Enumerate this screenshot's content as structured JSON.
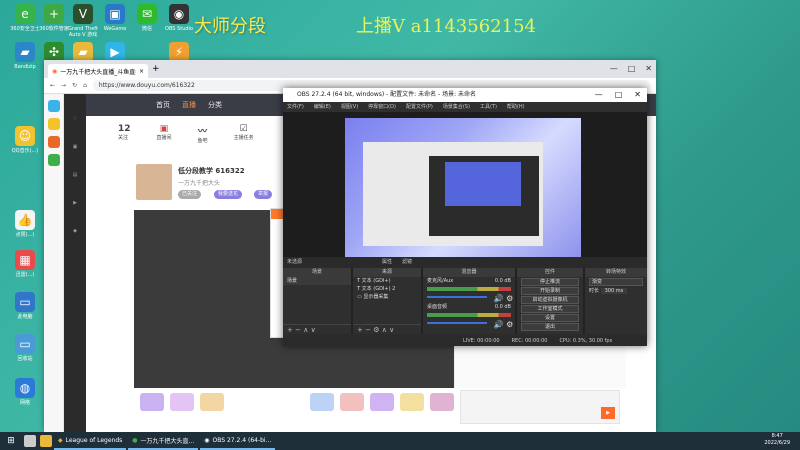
{
  "desktop": {
    "icons": [
      {
        "label": "360安全卫士",
        "color": "#36b34a",
        "glyph": "e-icon"
      },
      {
        "label": "360软件管家",
        "color": "#3ea845",
        "glyph": "plus-icon"
      },
      {
        "label": "Grand Theft Auto V 游戏",
        "color": "#2b4f2b",
        "glyph": "v-icon"
      },
      {
        "label": "WeGame",
        "color": "#2a79c9",
        "glyph": "wegame-icon"
      },
      {
        "label": "微信",
        "color": "#2dba2d",
        "glyph": "wechat-icon"
      },
      {
        "label": "OBS Studio",
        "color": "#333333",
        "glyph": "obs-icon"
      },
      {
        "label": "Bandizip",
        "color": "#2c87c9",
        "glyph": "folder-icon"
      },
      {
        "label": "风扇工具",
        "color": "#2e8c2e",
        "glyph": "fan-icon"
      },
      {
        "label": "新建文件夹",
        "color": "#e8b93a",
        "glyph": "folder-icon"
      },
      {
        "label": "腾讯视频",
        "color": "#2fb5e8",
        "glyph": "play-icon"
      },
      {
        "label": "快速访问",
        "color": "#f0a030",
        "glyph": "bolt-icon"
      },
      {
        "label": "QQ音乐(...)",
        "color": "#f2c331",
        "glyph": "smile-icon"
      },
      {
        "label": "点赞(...)",
        "color": "#f4f4f4",
        "glyph": "like-icon"
      },
      {
        "label": "迅雷(...)",
        "color": "#e84b4b",
        "glyph": "app-icon"
      },
      {
        "label": "此电脑",
        "color": "#3077c9",
        "glyph": "pc-icon"
      },
      {
        "label": "回收站",
        "color": "#4a9ad8",
        "glyph": "pc-icon"
      },
      {
        "label": "网络",
        "color": "#2b7ad8",
        "glyph": "globe-icon"
      }
    ],
    "overlay_left": "大师分段",
    "overlay_right": "上播V a1143562154"
  },
  "browser": {
    "tab_title": "一万九千把大头直播_斗鱼直播",
    "url": "https://www.douyu.com/616322",
    "site_nav": [
      "首页",
      "直播",
      "分类"
    ],
    "stats": [
      {
        "num": "12",
        "label": "关注"
      },
      {
        "num": "",
        "label": "直播间"
      },
      {
        "num": "",
        "label": "鱼吧"
      },
      {
        "num": "",
        "label": "主播任务"
      }
    ],
    "anchor_name": "低分段教学 616322",
    "anchor_sub": "一万九千把大头",
    "pills": [
      "已关注",
      "我要送花",
      "举报"
    ]
  },
  "obs": {
    "title": "OBS 27.2.4 (64 bit, windows) - 配置文件: 未命名 - 场景: 未命名",
    "menu": [
      "文件(F)",
      "编辑(E)",
      "视图(V)",
      "停靠窗口(D)",
      "配置文件(P)",
      "场景集合(S)",
      "工具(T)",
      "帮助(H)"
    ],
    "scene_label": "未选源",
    "scene_label_btns": [
      "属性",
      "滤镜"
    ],
    "docks": {
      "scenes": {
        "title": "场景",
        "items": [
          "场景"
        ]
      },
      "sources": {
        "title": "来源",
        "items": [
          "文本 (GDI+)",
          "文本 (GDI+) 2",
          "显示器采集"
        ]
      },
      "mixer": {
        "title": "混音器",
        "channels": [
          {
            "name": "麦克风/Aux",
            "db": "0.0 dB"
          },
          {
            "name": "桌面音频",
            "db": "0.0 dB"
          }
        ]
      },
      "controls": {
        "title": "控件",
        "buttons": [
          "停止推流",
          "开始录制",
          "启动虚拟摄像机",
          "工作室模式",
          "设置",
          "退出"
        ]
      },
      "transitions": {
        "title": "转场特效",
        "type": "渐变",
        "duration_label": "时长",
        "duration": "300 ms"
      }
    },
    "status": [
      "LIVE: 00:00:00",
      "REC: 00:00:00",
      "CPU: 0.3%, 30.00 fps"
    ]
  },
  "taskbar": {
    "tasks": [
      "League of Legends",
      "一万九千把大头直...",
      "OBS 27.2.4 (64-bi..."
    ],
    "time": "8:47",
    "date": "2022/6/29"
  }
}
